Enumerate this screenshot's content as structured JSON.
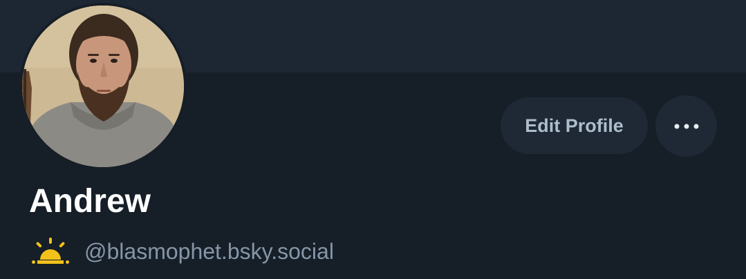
{
  "profile": {
    "display_name": "Andrew",
    "handle": "@blasmophet.bsky.social",
    "avatar_icon": "user-avatar-photo",
    "handle_prefix_icon": "sunrise-icon"
  },
  "actions": {
    "edit_profile_label": "Edit Profile",
    "more_icon": "more-horizontal-icon"
  },
  "colors": {
    "background": "#161e27",
    "banner": "#1d2733",
    "button_bg": "#1e2935",
    "button_text": "#aebdcc",
    "name_text": "#ffffff",
    "handle_text": "#8696a8",
    "sun_accent": "#f2c21b"
  }
}
